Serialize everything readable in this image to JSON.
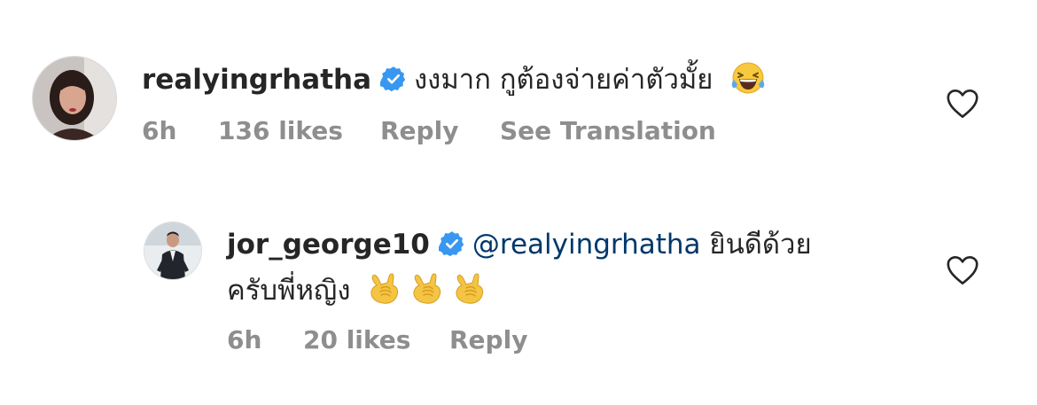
{
  "comments": [
    {
      "username": "realyingrhatha",
      "verified": true,
      "text_line1": "งงมาก กูต้องจ่ายค่าตัวมั้ย",
      "emoji": "face-with-tears-of-joy",
      "time": "6h",
      "likes": "136 likes",
      "reply_label": "Reply",
      "translation_label": "See Translation"
    },
    {
      "username": "jor_george10",
      "verified": true,
      "mention": "@realyingrhatha",
      "text_line1": "ยินดีด้วย",
      "text_line2": "ครับพี่หญิง",
      "emoji": "sign-of-the-horns",
      "emoji_count": 3,
      "time": "6h",
      "likes": "20 likes",
      "reply_label": "Reply"
    }
  ],
  "colors": {
    "text": "#262626",
    "secondary": "#8e8e8e",
    "mention": "#00376b",
    "verified_badge": "#3897f0"
  }
}
